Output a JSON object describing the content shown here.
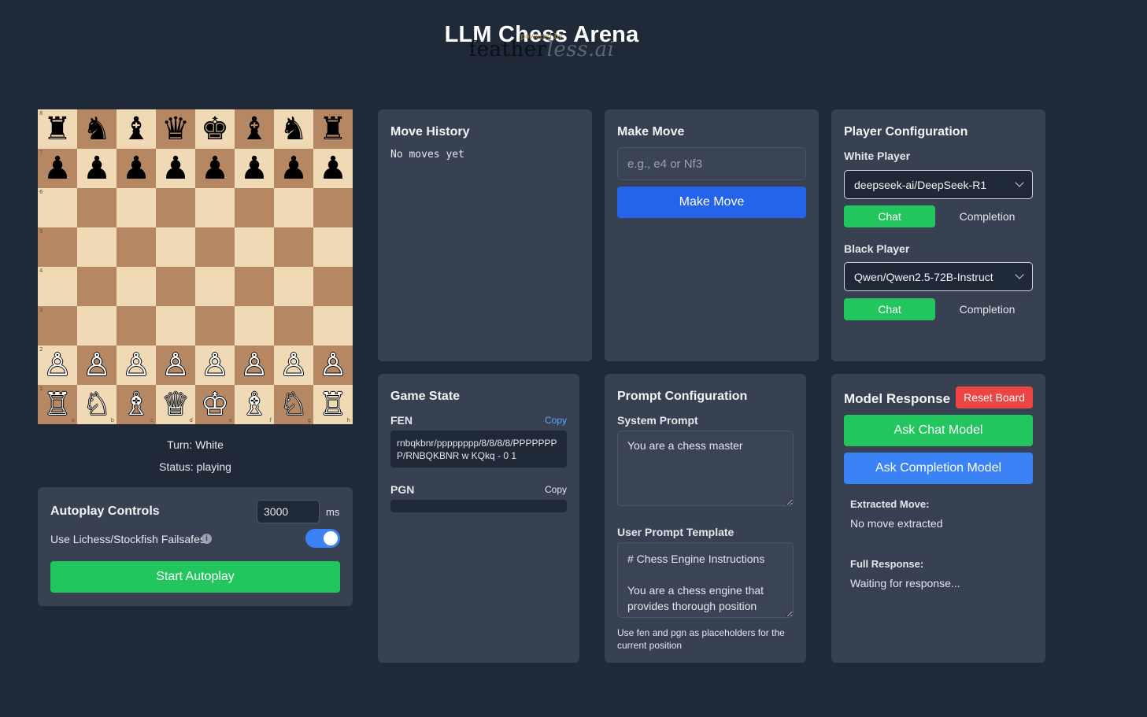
{
  "app": {
    "title": "LLM Chess Arena",
    "powered_by": "powered by",
    "logo_dark": "feather",
    "logo_light": "less.ai"
  },
  "board": {
    "rank8": [
      "♜",
      "♞",
      "♝",
      "♛",
      "♚",
      "♝",
      "♞",
      "♜"
    ],
    "rank7": [
      "♟",
      "♟",
      "♟",
      "♟",
      "♟",
      "♟",
      "♟",
      "♟"
    ],
    "rank2": [
      "♙",
      "♙",
      "♙",
      "♙",
      "♙",
      "♙",
      "♙",
      "♙"
    ],
    "rank1": [
      "♖",
      "♘",
      "♗",
      "♕",
      "♔",
      "♗",
      "♘",
      "♖"
    ],
    "rank_labels": [
      "8",
      "7",
      "6",
      "5",
      "4",
      "3",
      "2",
      "1"
    ],
    "file_labels": [
      "a",
      "b",
      "c",
      "d",
      "e",
      "f",
      "g",
      "h"
    ],
    "turn": "Turn: White",
    "status": "Status: playing"
  },
  "autoplay": {
    "title": "Autoplay Controls",
    "interval_value": "3000",
    "interval_unit": "ms",
    "failsafe_label": "Use Lichess/Stockfish Failsafes",
    "failsafe_enabled": true,
    "start_label": "Start Autoplay"
  },
  "move_history": {
    "title": "Move History",
    "empty_text": "No moves yet"
  },
  "make_move": {
    "title": "Make Move",
    "placeholder": "e.g., e4 or Nf3",
    "button_label": "Make Move"
  },
  "player_config": {
    "title": "Player Configuration",
    "white_label": "White Player",
    "white_model": "deepseek-ai/DeepSeek-R1",
    "white_mode_chat": "Chat",
    "white_mode_completion": "Completion",
    "black_label": "Black Player",
    "black_model": "Qwen/Qwen2.5-72B-Instruct",
    "black_mode_chat": "Chat",
    "black_mode_completion": "Completion"
  },
  "game_state": {
    "title": "Game State",
    "fen_label": "FEN",
    "fen_copy": "Copy",
    "fen_value": "rnbqkbnr/pppppppp/8/8/8/8/PPPPPPPP/RNBQKBNR w KQkq - 0 1",
    "pgn_label": "PGN",
    "pgn_copy": "Copy",
    "pgn_value": ""
  },
  "prompt_config": {
    "title": "Prompt Configuration",
    "system_label": "System Prompt",
    "system_value": "You are a chess master",
    "user_label": "User Prompt Template",
    "user_value": "# Chess Engine Instructions\n\nYou are a chess engine that provides thorough position analysis before making a move.",
    "hint": "Use fen and pgn as placeholders for the current position"
  },
  "model_response": {
    "title": "Model Response",
    "reset_label": "Reset Board",
    "ask_chat_label": "Ask Chat Model",
    "ask_completion_label": "Ask Completion Model",
    "extracted_label": "Extracted Move:",
    "extracted_value": "No move extracted",
    "full_label": "Full Response:",
    "full_value": "Waiting for response..."
  },
  "colors": {
    "background": "#1f2937",
    "panel": "#374151",
    "light_square": "#f0d9b5",
    "dark_square": "#b58863",
    "green": "#22c55e",
    "blue": "#2563eb",
    "red": "#ef4444"
  },
  "icons": {
    "info": "info-icon",
    "dropdown": "chevron-down-icon"
  }
}
